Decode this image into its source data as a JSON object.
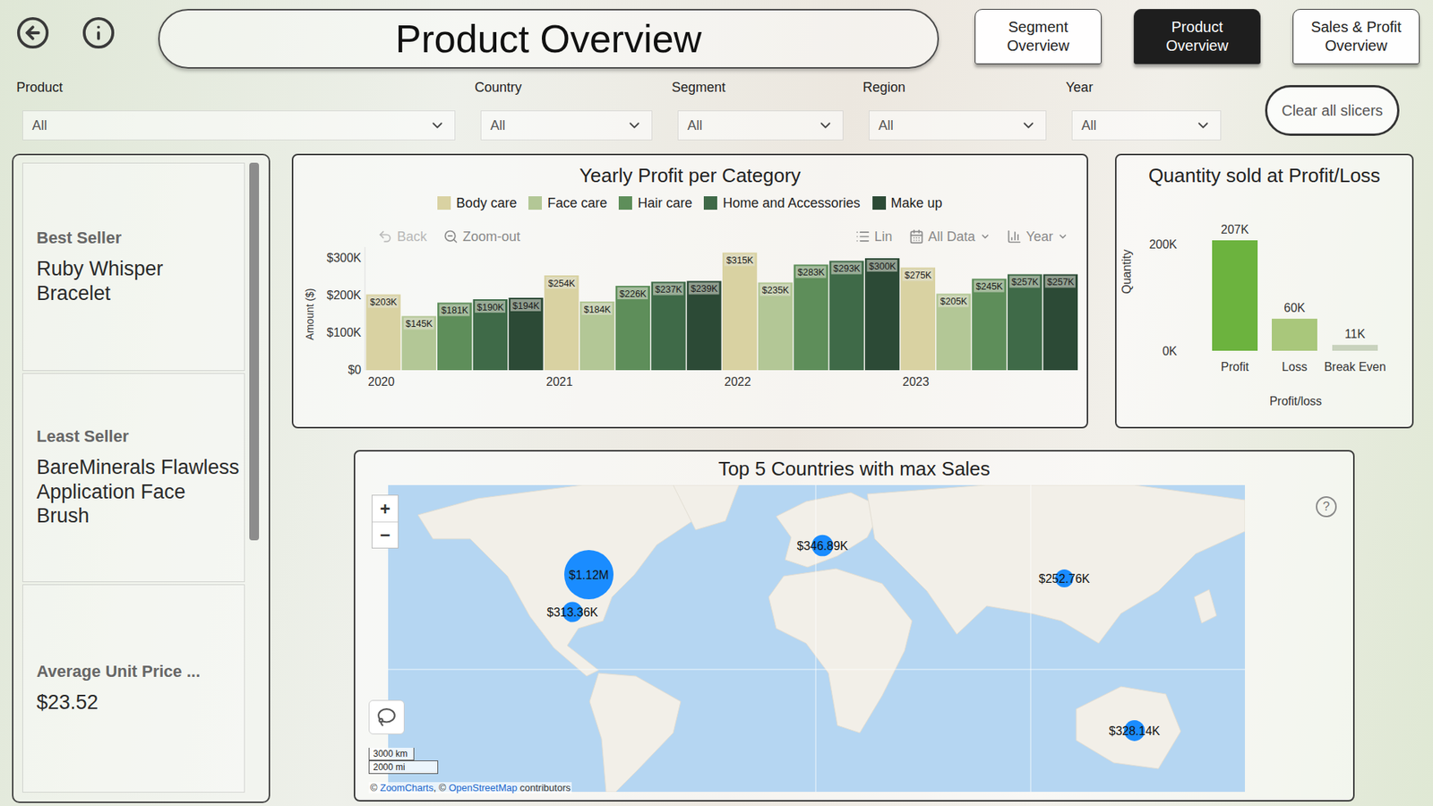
{
  "header": {
    "title": "Product Overview",
    "nav": [
      {
        "label": "Segment Overview",
        "selected": false
      },
      {
        "label": "Product Overview",
        "selected": true
      },
      {
        "label": "Sales & Profit Overview",
        "selected": false
      }
    ]
  },
  "slicers": [
    {
      "label": "Product",
      "value": "All"
    },
    {
      "label": "Country",
      "value": "All"
    },
    {
      "label": "Segment",
      "value": "All"
    },
    {
      "label": "Region",
      "value": "All"
    },
    {
      "label": "Year",
      "value": "All"
    }
  ],
  "clear_button": {
    "label": "Clear all slicers"
  },
  "kpi_cards": [
    {
      "label": "Best Seller",
      "value": "Ruby Whisper Bracelet"
    },
    {
      "label": "Least Seller",
      "value": "BareMinerals Flawless Application Face Brush"
    },
    {
      "label": "Average Unit Price ...",
      "value": "$23.52"
    }
  ],
  "kpi_scrollbar": {
    "level": 0.6
  },
  "profit_chart": {
    "title": "Yearly Profit per Category",
    "y_axis_title": "Amount ($)",
    "y_ticks": [
      "$300K",
      "$200K",
      "$100K",
      "$0"
    ],
    "y_tick_values": [
      300000,
      200000,
      100000,
      0
    ],
    "toolbar_left": [
      {
        "label": "Back",
        "kind": "button",
        "disabled": true
      },
      {
        "label": "Zoom-out",
        "kind": "button",
        "disabled": false
      }
    ],
    "toolbar_right": [
      {
        "label": "Lin",
        "kind": "toggle",
        "disabled": false
      },
      {
        "label": "All Data",
        "kind": "dropdown",
        "disabled": false
      },
      {
        "label": "Year",
        "kind": "dropdown",
        "disabled": false
      }
    ],
    "years": [
      "2020",
      "2021",
      "2022",
      "2023"
    ],
    "series": [
      {
        "name": "Body care",
        "color": "#d9d2a2",
        "values": [
          203000,
          254000,
          315000,
          275000
        ],
        "labels": [
          "$203K",
          "$254K",
          "$315K",
          "$275K"
        ]
      },
      {
        "name": "Face care",
        "color": "#b3c796",
        "values": [
          145000,
          184000,
          235000,
          205000
        ],
        "labels": [
          "$145K",
          "$184K",
          "$235K",
          "$205K"
        ]
      },
      {
        "name": "Hair care",
        "color": "#5e8e5a",
        "values": [
          181000,
          226000,
          283000,
          245000
        ],
        "labels": [
          "$181K",
          "$226K",
          "$283K",
          "$245K"
        ]
      },
      {
        "name": "Home and Accessories",
        "color": "#3f6a48",
        "values": [
          190000,
          237000,
          293000,
          257000
        ],
        "labels": [
          "$190K",
          "$237K",
          "$293K",
          "$257K"
        ]
      },
      {
        "name": "Make up",
        "color": "#2c4a36",
        "values": [
          194000,
          239000,
          300000,
          257000
        ],
        "labels": [
          "$194K",
          "$239K",
          "$300K",
          "$257K"
        ]
      }
    ]
  },
  "quantity_chart": {
    "title": "Quantity sold at Profit/Loss",
    "y_axis_title": "Quantity",
    "x_axis_title": "Profit/loss",
    "y_ticks": [
      "200K",
      "0K"
    ],
    "y_tick_values": [
      200000,
      0
    ],
    "bars": [
      {
        "label": "Profit",
        "value": 207000,
        "reading": "207K",
        "color": "#6cb33e"
      },
      {
        "label": "Loss",
        "value": 60000,
        "reading": "60K",
        "color": "#a9c77b"
      },
      {
        "label": "Break Even",
        "value": 11000,
        "reading": "11K",
        "color": "#c8d2bd"
      }
    ]
  },
  "map": {
    "title": "Top 5 Countries with max Sales",
    "help": "?",
    "zoom_in": "+",
    "zoom_out": "−",
    "bubbles": [
      {
        "label": "$1.12M",
        "value": 1120000
      },
      {
        "label": "$313.36K",
        "value": 313360
      },
      {
        "label": "$346.89K",
        "value": 346890
      },
      {
        "label": "$252.76K",
        "value": 252760
      },
      {
        "label": "$328.14K",
        "value": 328140
      }
    ],
    "scale": [
      "3000 km",
      "2000 mi"
    ],
    "attribution": [
      {
        "text": "© ",
        "link": false
      },
      {
        "text": "ZoomCharts",
        "link": true
      },
      {
        "text": ", © ",
        "link": false
      },
      {
        "text": "OpenStreetMap",
        "link": true
      },
      {
        "text": " contributors",
        "link": false
      }
    ]
  }
}
